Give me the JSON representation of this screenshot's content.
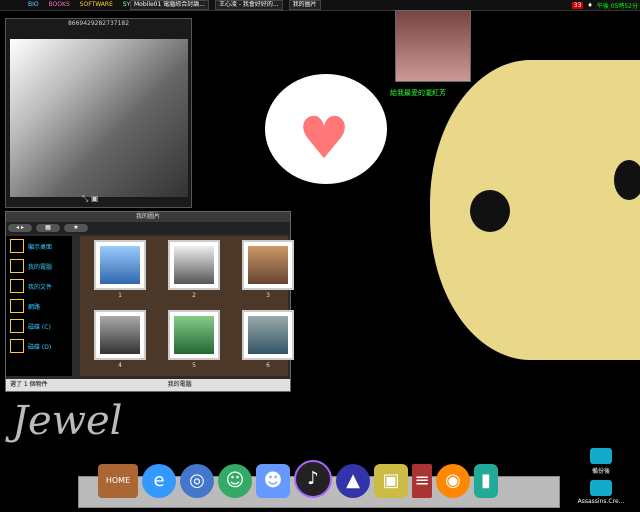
{
  "topbar": {
    "menu": [
      "BIO",
      "BOOKS",
      "SOFTWARE",
      "SYSTEM"
    ],
    "tasks": [
      "Mobile01 電腦綜合討論...",
      "王心凌 - 我會好好的...",
      "我的圖片"
    ],
    "tray_badge": "33",
    "clock": "午後 05時52分"
  },
  "photo_widget": {
    "title": "8669429282737182"
  },
  "profile": {
    "caption": "給我最愛的瀧紅芳"
  },
  "explorer": {
    "title": "我的圖片",
    "sidebar": [
      "顯示桌面",
      "我的電腦",
      "我的文件",
      "網路",
      "磁碟 (C)",
      "磁碟 (D)"
    ],
    "thumbs": [
      "1",
      "2",
      "3",
      "4",
      "5",
      "6"
    ],
    "status_left": "選了 1 個物件",
    "status_right": "我的電腦"
  },
  "signature": {
    "text": "Jewel"
  },
  "dock": {
    "home_label": "HOME",
    "icons": [
      "home-icon",
      "ie-icon",
      "globe-icon",
      "messenger-icon",
      "finder-icon",
      "media-icon",
      "wizard-icon",
      "truck-icon",
      "ladder-icon",
      "pumpkin-icon",
      "battery-icon"
    ]
  },
  "desktop_icons": [
    {
      "label": "備份後"
    },
    {
      "label": "Assassins.Cre..."
    }
  ]
}
